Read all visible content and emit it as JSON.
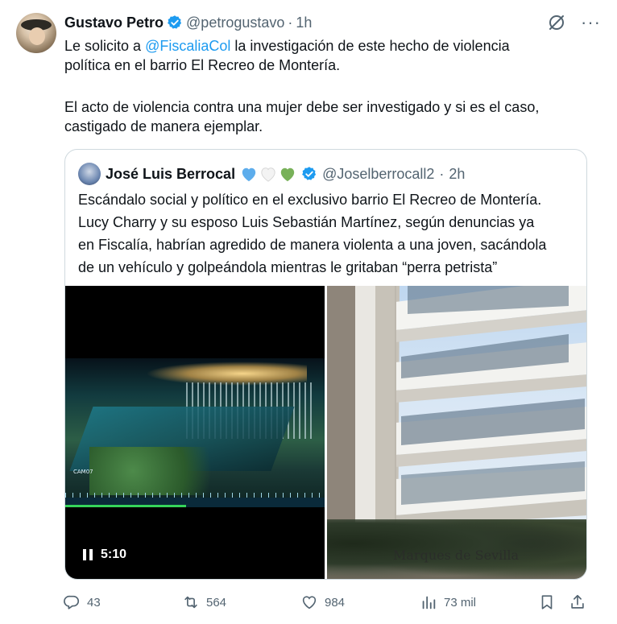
{
  "tweet": {
    "author_name": "Gustavo Petro",
    "author_handle": "@petrogustavo",
    "separator": "·",
    "time": "1h",
    "more_label": "···",
    "text_line1_pre": "Le solicito a ",
    "mention": "@FiscaliaCol",
    "text_line1_post": " la investigación de este hecho de violencia",
    "text_line2": "política en el barrio El Recreo de Montería.",
    "text_line3": "El acto de violencia contra una mujer debe ser investigado y si es el caso,",
    "text_line4": "castigado de manera ejemplar."
  },
  "quote": {
    "author_name": "José Luis Berrocal",
    "hearts": [
      "blue",
      "white",
      "green"
    ],
    "author_handle": "@Joselberrocall2",
    "separator": "·",
    "time": "2h",
    "text_line1": "Escándalo social y político en el exclusivo barrio El Recreo de Montería.",
    "text_line2": "Lucy Charry y su esposo Luis Sebastián Martínez, según denuncias ya",
    "text_line3": "en Fiscalía, habrían agredido de manera violenta a una joven, sacándola",
    "text_line4": "de un vehículo y golpeándola mientras le gritaban “perra petrista”",
    "video": {
      "duration": "5:10",
      "camera_label": "CAM07",
      "timeline_labels": [
        "10",
        "11",
        "12",
        "13",
        "14",
        "15"
      ]
    },
    "photo_sign": "Marques de Sevilla"
  },
  "actions": {
    "replies": "43",
    "reposts": "564",
    "likes": "984",
    "views": "73 mil"
  },
  "colors": {
    "accent": "#1d9bf0",
    "muted": "#536471",
    "text": "#0f1419",
    "border": "#cfd9de"
  }
}
